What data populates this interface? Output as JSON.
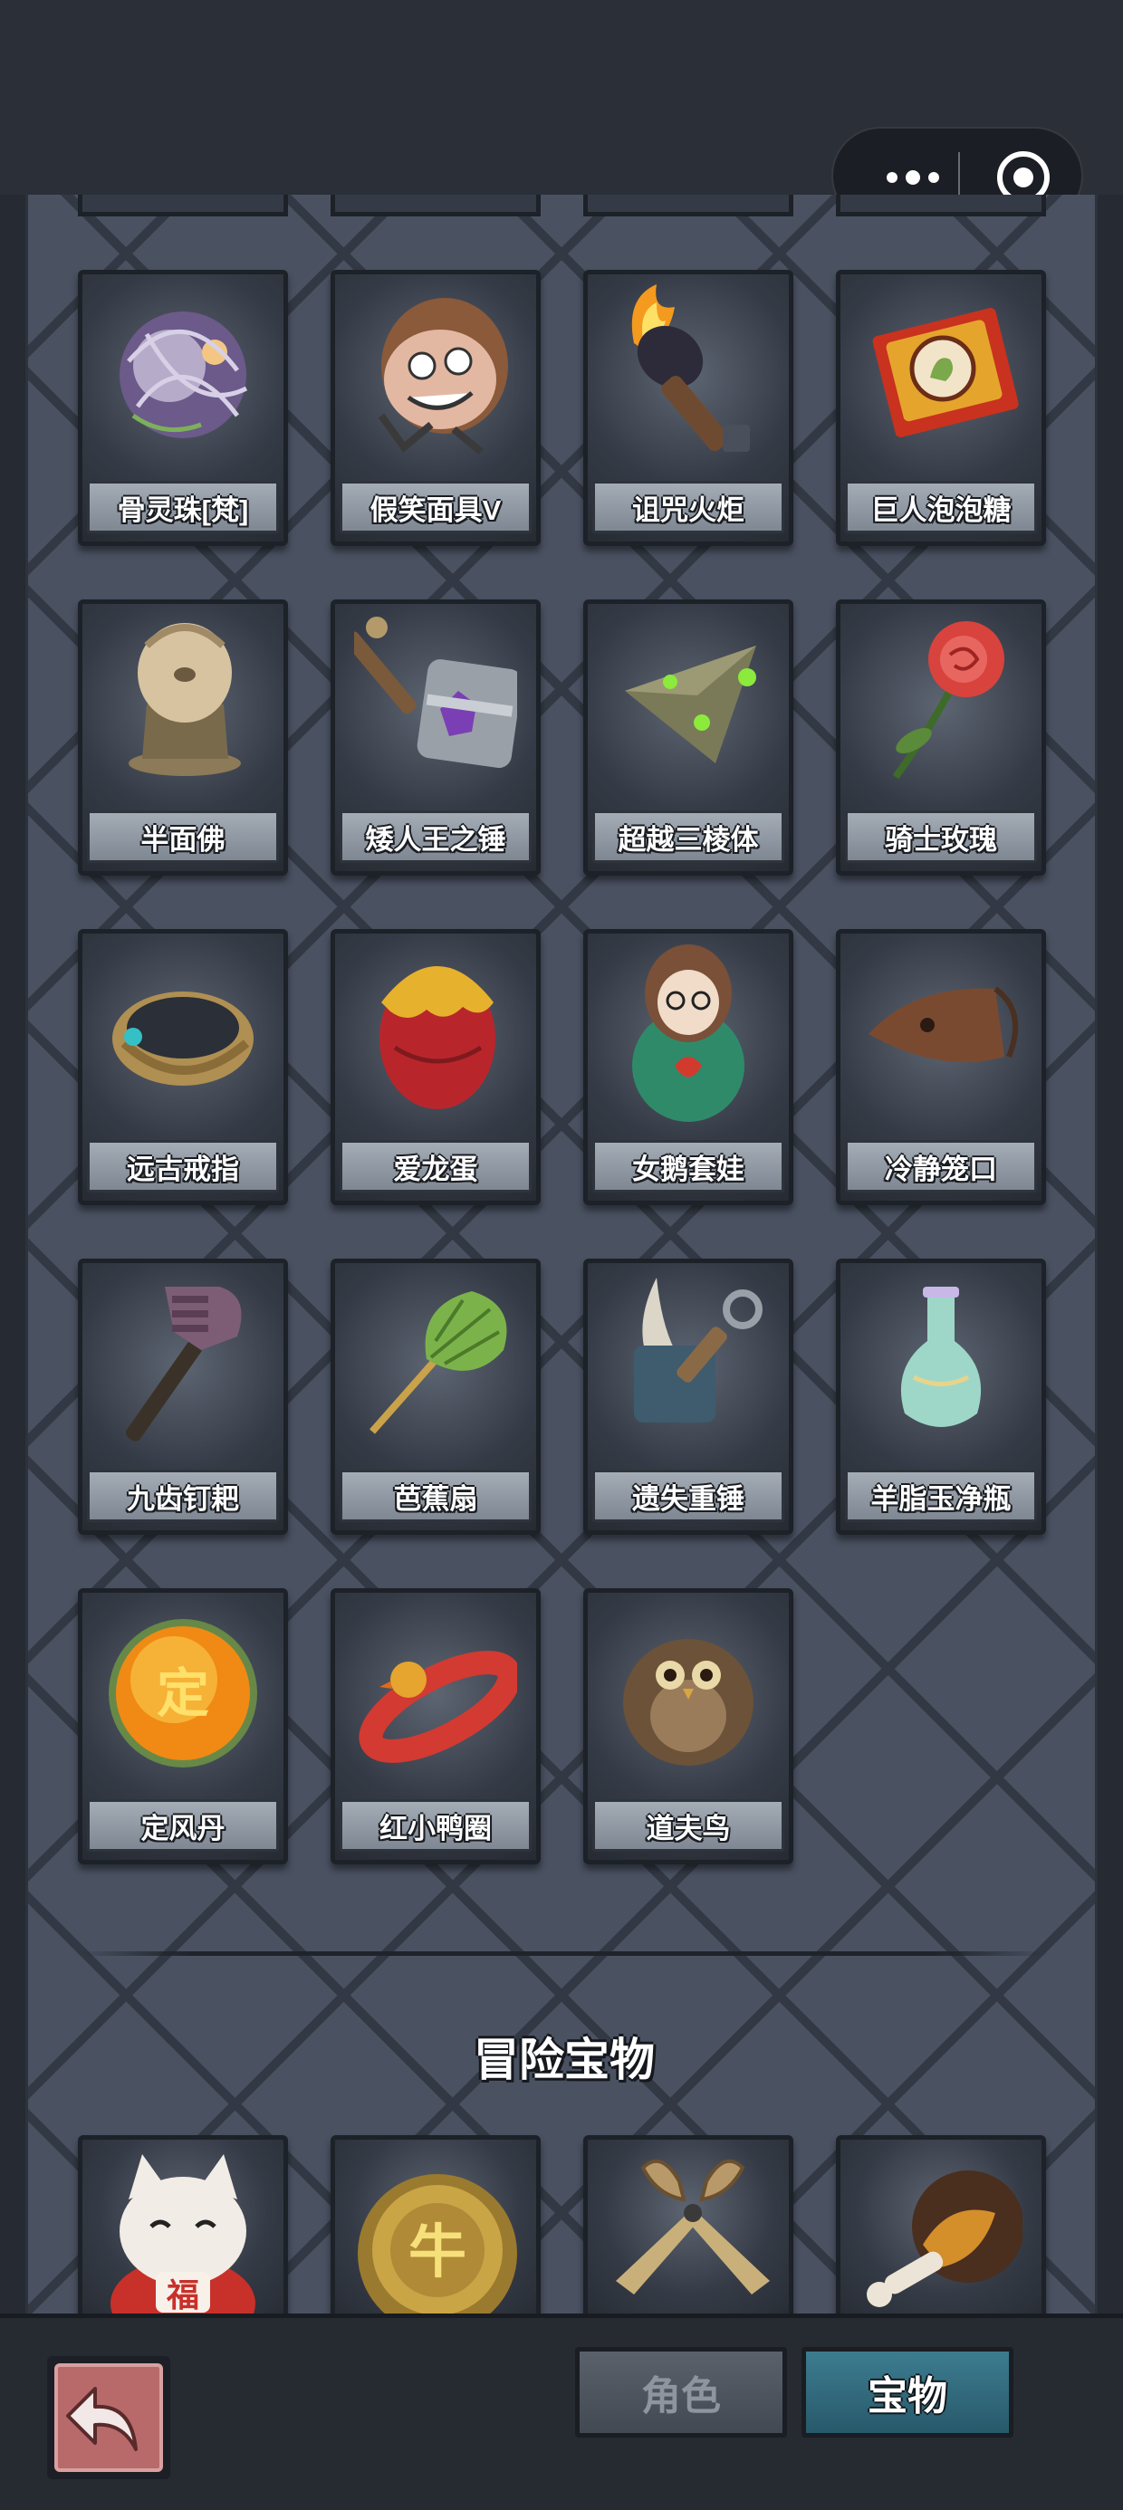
{
  "header": {
    "menu_icon": "more-dots-icon",
    "close_icon": "target-circle-icon"
  },
  "items": [
    {
      "name": "骨灵珠[梵]",
      "icon": "bone-spirit-orb-icon"
    },
    {
      "name": "假笑面具V",
      "icon": "smile-mask-icon"
    },
    {
      "name": "诅咒火炬",
      "icon": "cursed-torch-icon"
    },
    {
      "name": "巨人泡泡糖",
      "icon": "giant-bubblegum-icon"
    },
    {
      "name": "半面佛",
      "icon": "half-buddha-icon"
    },
    {
      "name": "矮人王之锤",
      "icon": "dwarf-hammer-icon"
    },
    {
      "name": "超越三棱体",
      "icon": "prism-icon"
    },
    {
      "name": "骑士玫瑰",
      "icon": "rose-icon"
    },
    {
      "name": "远古戒指",
      "icon": "ancient-ring-icon"
    },
    {
      "name": "爱龙蛋",
      "icon": "dragon-egg-icon"
    },
    {
      "name": "女鹅套娃",
      "icon": "nesting-doll-icon"
    },
    {
      "name": "冷静笼口",
      "icon": "muzzle-icon"
    },
    {
      "name": "九齿钉耙",
      "icon": "rake-icon"
    },
    {
      "name": "芭蕉扇",
      "icon": "banana-fan-icon"
    },
    {
      "name": "遗失重锤",
      "icon": "lost-hammer-icon"
    },
    {
      "name": "羊脂玉净瓶",
      "icon": "jade-vase-icon"
    },
    {
      "name": "定风丹",
      "icon": "wind-pearl-icon"
    },
    {
      "name": "红小鸭圈",
      "icon": "duck-ring-icon"
    },
    {
      "name": "道夫鸟",
      "icon": "owl-icon"
    }
  ],
  "adventure_section": {
    "title": "冒险宝物",
    "items": [
      {
        "icon": "lucky-cat-icon",
        "badge": "福"
      },
      {
        "icon": "gold-coin-icon",
        "badge": "牛"
      },
      {
        "icon": "scissors-icon"
      },
      {
        "icon": "drumstick-icon"
      }
    ]
  },
  "bottom_nav": {
    "back_icon": "return-arrow-icon",
    "tabs": [
      {
        "label": "角色",
        "active": false
      },
      {
        "label": "宝物",
        "active": true
      }
    ]
  },
  "colors": {
    "panel": "#4a5262",
    "active_tab": "#3d7c90",
    "inactive_tab": "#4d535c",
    "label_bg": "#939ba6"
  }
}
